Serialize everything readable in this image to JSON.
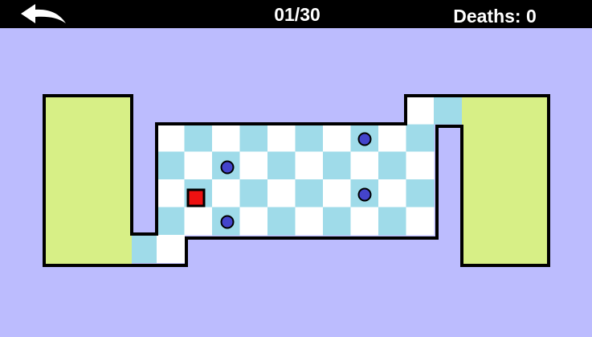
{
  "hud": {
    "back_icon": "back-arrow-icon",
    "level": "01/30",
    "deaths_label": "Deaths:",
    "deaths_value": "0"
  },
  "colors": {
    "background": "#bcbcfe",
    "hud_bar": "#000000",
    "safe_zone": "#d7ef86",
    "tile_light": "#ffffff",
    "tile_dark": "#9fdbe9",
    "wall": "#000000",
    "player": "#ee1111",
    "enemy": "#4444cc"
  }
}
